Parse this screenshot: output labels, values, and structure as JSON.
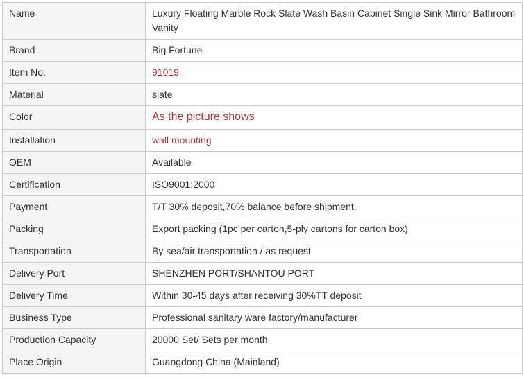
{
  "colors": {
    "accent": "#b23c3c",
    "label_bg": "#f5f5f5",
    "border": "#cccccc",
    "text": "#333333"
  },
  "specs": [
    {
      "label": "Name",
      "value": "Luxury Floating Marble Rock Slate Wash Basin Cabinet Single Sink Mirror Bathroom Vanity"
    },
    {
      "label": "Brand",
      "value": "Big Fortune"
    },
    {
      "label": "Item No.",
      "value": "91019"
    },
    {
      "label": "Material",
      "value": "slate"
    },
    {
      "label": "Color",
      "value": "As the picture shows"
    },
    {
      "label": "Installation",
      "value": "wall mounting"
    },
    {
      "label": "OEM",
      "value": "Available"
    },
    {
      "label": "Certification",
      "value": "ISO9001:2000"
    },
    {
      "label": "Payment",
      "value": "T/T 30% deposit,70% balance before shipment."
    },
    {
      "label": "Packing",
      "value": "Export packing (1pc per carton,5-ply cartons for carton box)"
    },
    {
      "label": "Transportation",
      "value": "By sea/air transportation / as request"
    },
    {
      "label": "Delivery Port",
      "value": "SHENZHEN PORT/SHANTOU PORT"
    },
    {
      "label": "Delivery Time",
      "value": "Within 30-45 days after receiving 30%TT deposit"
    },
    {
      "label": "Business Type",
      "value": "Professional sanitary ware factory/manufacturer"
    },
    {
      "label": "Production Capacity",
      "value": "20000 Set/ Sets per month"
    },
    {
      "label": "Place Origin",
      "value": "Guangdong China (Mainland)"
    }
  ]
}
